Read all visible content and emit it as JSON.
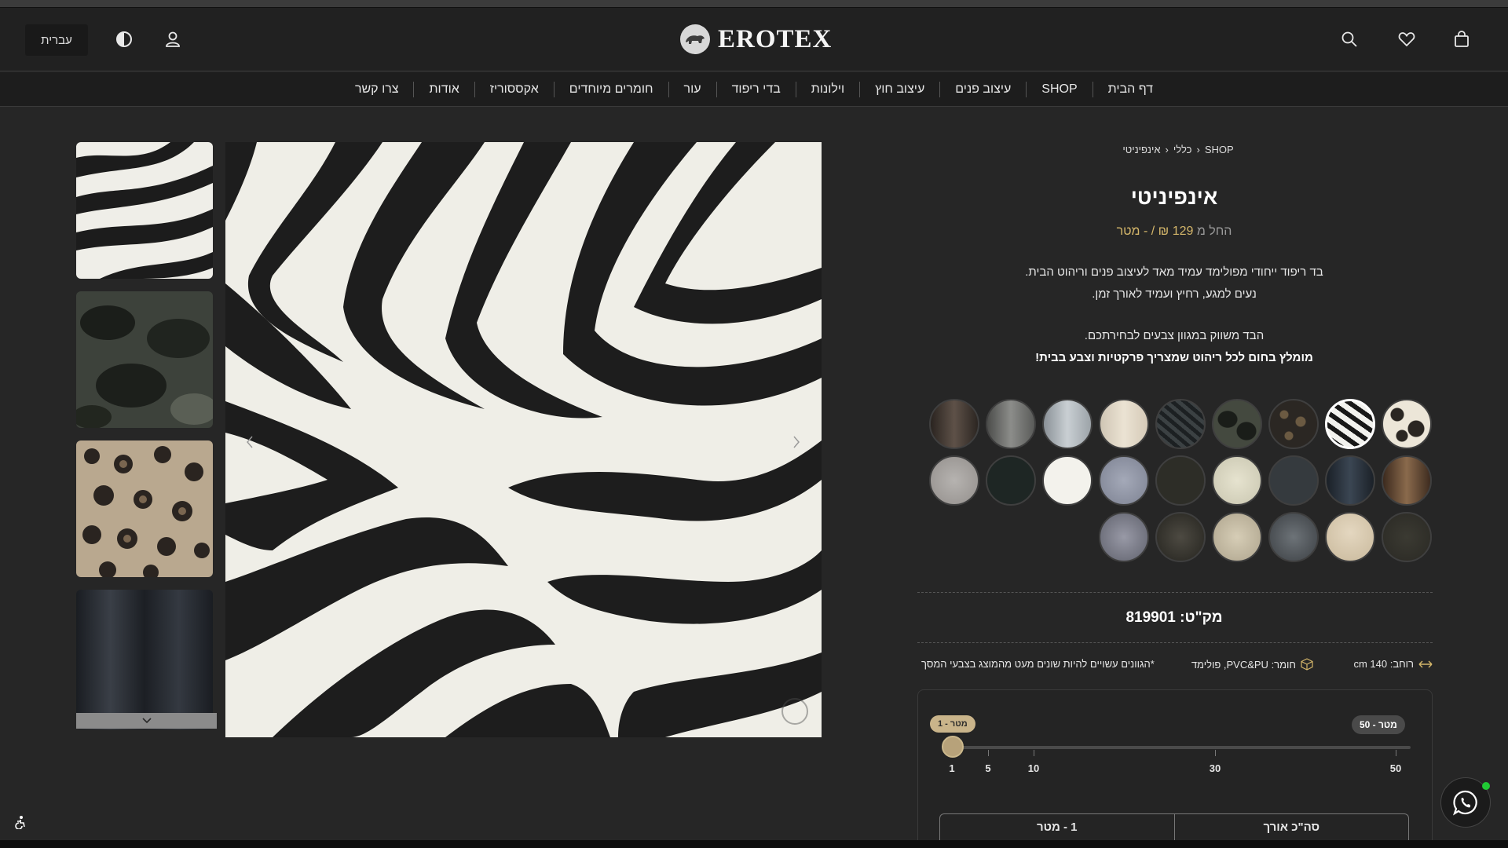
{
  "header": {
    "language_label": "עברית",
    "logo_text": "EROTEX",
    "icons": [
      "contrast-icon",
      "user-icon",
      "search-icon",
      "heart-icon",
      "shopping-bag-icon"
    ]
  },
  "nav": {
    "items": [
      "דף הבית",
      "SHOP",
      "עיצוב פנים",
      "עיצוב חוץ",
      "וילונות",
      "בדי ריפוד",
      "עור",
      "חומרים מיוחדים",
      "אקססוריז",
      "אודות",
      "צרו קשר"
    ]
  },
  "breadcrumb": [
    "SHOP",
    "כללי",
    "אינפיניטי"
  ],
  "product": {
    "title": "אינפיניטי",
    "price_prefix": "החל מ",
    "price": "129 ₪ / - מטר",
    "description_lines": [
      "בד ריפוד ייחודי מפולימד עמיד מאד לעיצוב פנים וריהוט הבית.",
      "נעים למגע, רחיץ ועמיד לאורך זמן.",
      "הבד משווק במגוון צבעים לבחירתכם.",
      "מומלץ בחום לכל ריהוט שמצריך פרקטיות וצבע בבית!"
    ],
    "sku": "מק\"ט: 819901",
    "specs": {
      "width": "רוחב: 140 cm",
      "material": "חומר: PVC&PU, פולימד",
      "note": "*הגוונים עשויים להיות שונים מעט מהמוצג בצבעי המסך"
    }
  },
  "swatches": {
    "selected_index": 1,
    "items": [
      "cream-black-spots",
      "zebra",
      "leopard-dark",
      "camo-dark",
      "zebra-dark",
      "cream",
      "silver-gray",
      "charcoal-gray",
      "dark-brown",
      "brown-stripe",
      "navy-stripe",
      "dark-slate",
      "cream-textured",
      "dark-olive",
      "blue-gray",
      "white",
      "dark-green",
      "light-gray",
      "dark-mottle",
      "cream-solid",
      "steel-mottle",
      "cream-mottle",
      "black-mottle",
      "gray-mottle"
    ]
  },
  "quantity": {
    "min_label": "1 - מטר",
    "max_label": "50 - מטר",
    "ticks": [
      "1",
      "5",
      "10",
      "30",
      "50"
    ],
    "tick_values": [
      1,
      5,
      10,
      30,
      50
    ],
    "current_value": 1,
    "total_length_label": "סה\"כ אורך",
    "total_length_value": "1 - מטר"
  },
  "colors": {
    "accent_gold": "#d4b66a",
    "whatsapp_status": "#20c934"
  }
}
